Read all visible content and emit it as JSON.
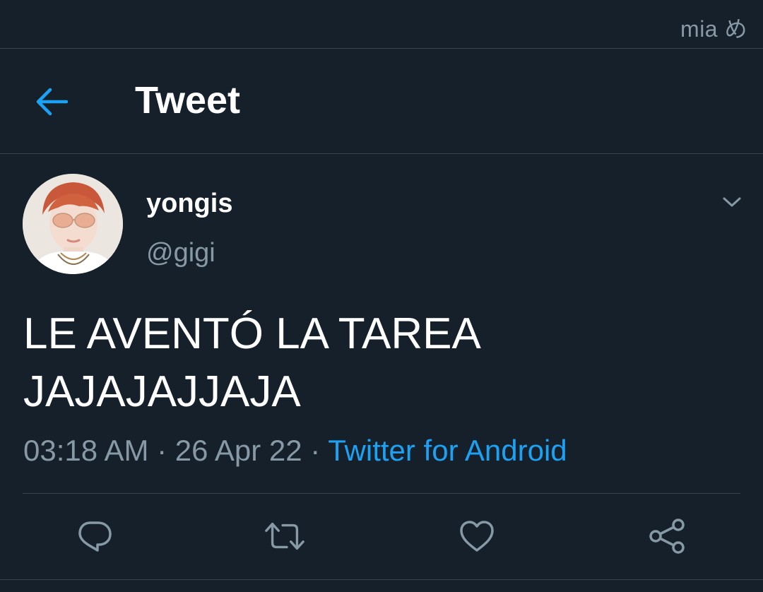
{
  "watermark": "mia め",
  "header": {
    "title": "Tweet",
    "back_icon": "arrow-left-icon"
  },
  "tweet": {
    "display_name": "yongis",
    "handle": "@gigi",
    "text_line1": "LE AVENTÓ LA TAREA",
    "text_line2": "JAJAJAJJAJA",
    "time": "03:18 AM",
    "sep1": " · ",
    "date": "26 Apr 22",
    "sep2": " · ",
    "source": "Twitter for Android",
    "menu_icon": "chevron-down-icon"
  },
  "actions": [
    {
      "icon": "reply-icon"
    },
    {
      "icon": "retweet-icon"
    },
    {
      "icon": "like-icon"
    },
    {
      "icon": "share-icon"
    }
  ],
  "colors": {
    "background": "#15202b",
    "divider": "#38444d",
    "muted_text": "#8899a6",
    "accent": "#1da1f2"
  }
}
